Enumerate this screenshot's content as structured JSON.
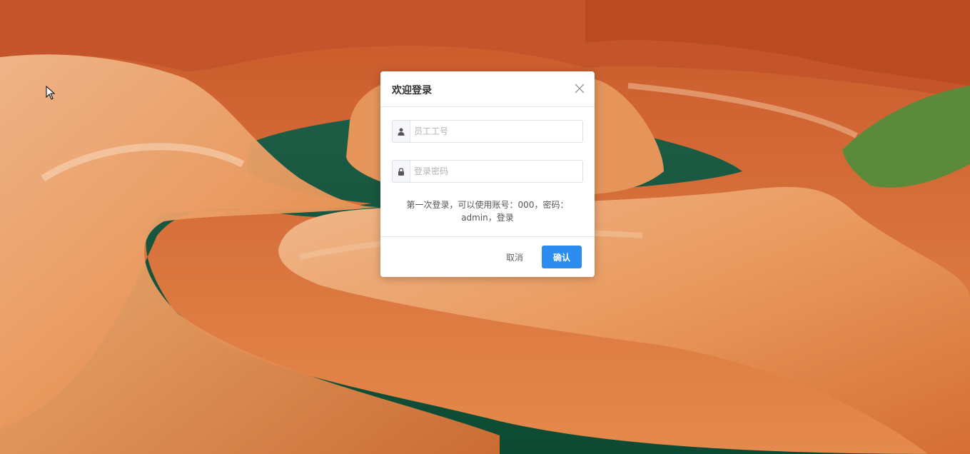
{
  "dialog": {
    "title": "欢迎登录",
    "username_placeholder": "员工工号",
    "password_placeholder": "登录密码",
    "hint": "第一次登录，可以使用账号：000，密码：admin，登录",
    "cancel_label": "取消",
    "confirm_label": "确认"
  },
  "icons": {
    "close": "close-icon",
    "user": "user-icon",
    "lock": "lock-icon"
  },
  "colors": {
    "primary": "#2d8cf0",
    "canyon": "#d9743a",
    "river": "#0f5a3c"
  }
}
